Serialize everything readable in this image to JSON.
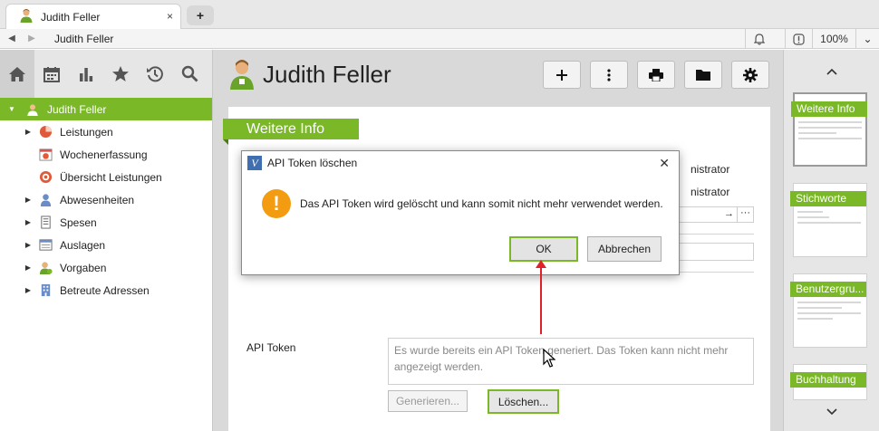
{
  "browser": {
    "tab_title": "Judith Feller",
    "tab_close": "×",
    "new_tab": "+",
    "url_text": "Judith Feller",
    "zoom": "100%"
  },
  "sidebar": {
    "root": "Judith Feller",
    "items": [
      {
        "label": "Leistungen",
        "icon": "pie-chart-icon",
        "expandable": true
      },
      {
        "label": "Wochenerfassung",
        "icon": "week-entry-icon",
        "expandable": false
      },
      {
        "label": "Übersicht Leistungen",
        "icon": "overview-icon",
        "expandable": false
      },
      {
        "label": "Abwesenheiten",
        "icon": "absence-icon",
        "expandable": true
      },
      {
        "label": "Spesen",
        "icon": "expenses-icon",
        "expandable": true
      },
      {
        "label": "Auslagen",
        "icon": "outlays-icon",
        "expandable": true
      },
      {
        "label": "Vorgaben",
        "icon": "targets-icon",
        "expandable": true
      },
      {
        "label": "Betreute Adressen",
        "icon": "building-icon",
        "expandable": true
      }
    ]
  },
  "main": {
    "title": "Judith Feller",
    "section": "Weitere Info",
    "bg_text_1": "nistrator",
    "bg_text_2": "nistrator",
    "api_token_label": "API Token",
    "api_token_text": "Es wurde bereits ein API Token generiert. Das Token kann nicht mehr angezeigt werden.",
    "generate_button": "Generieren...",
    "delete_button": "Löschen..."
  },
  "dialog": {
    "title": "API Token löschen",
    "message": "Das API Token wird gelöscht und kann somit nicht mehr verwendet werden.",
    "ok_button": "OK",
    "cancel_button": "Abbrechen",
    "close": "✕"
  },
  "rightpane": {
    "thumbnails": [
      "Weitere Info",
      "Stichworte",
      "Benutzergru...",
      "Buchhaltung"
    ]
  },
  "colors": {
    "accent": "#7ab828",
    "warning": "#f39c12",
    "annotation": "#e0202a"
  }
}
